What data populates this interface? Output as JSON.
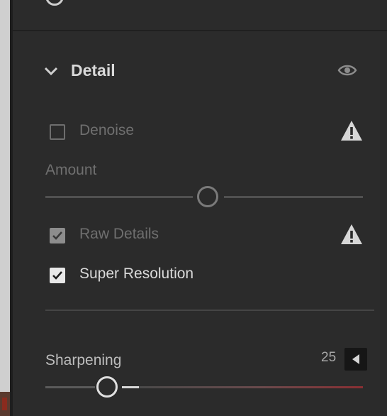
{
  "detail": {
    "title": "Detail",
    "denoise": {
      "label": "Denoise",
      "checked": false
    },
    "amount": {
      "label": "Amount",
      "value": 0.5
    },
    "raw_details": {
      "label": "Raw Details",
      "checked": true
    },
    "super_resolution": {
      "label": "Super Resolution",
      "checked": true
    }
  },
  "sharpening": {
    "label": "Sharpening",
    "value": "25",
    "slider_fraction": 0.19
  },
  "colors": {
    "background": "#2b2b2b",
    "text": "#d6d6d6",
    "dim_text": "#6f6f6f",
    "warning_fill": "#d7d7d7",
    "sharpening_track_end": "#8a2f33"
  },
  "icons": {
    "section_toggle": "chevron-down-icon",
    "visibility": "eye-icon",
    "denoise_warning": "warning-triangle-icon",
    "raw_details_warning": "warning-triangle-icon",
    "sharpening_step": "triangle-left-icon"
  }
}
